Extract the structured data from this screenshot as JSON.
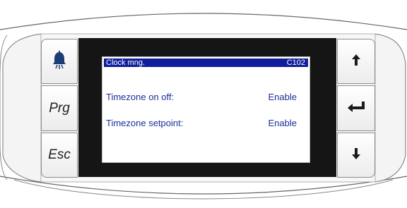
{
  "keypad": {
    "alarm_icon": "bell-icon",
    "prg_label": "Prg",
    "esc_label": "Esc",
    "up_icon": "arrow-up-icon",
    "enter_icon": "enter-icon",
    "down_icon": "arrow-down-icon"
  },
  "screen": {
    "title": "Clock mng.",
    "code": "C102",
    "rows": [
      {
        "label": "Timezone on off:",
        "value": "Enable"
      },
      {
        "label": "Timezone setpoint:",
        "value": "Enable"
      }
    ]
  },
  "colors": {
    "header_bg": "#111e9c",
    "text": "#1b2f9a",
    "frame": "#151515",
    "bell": "#1c3d73"
  }
}
